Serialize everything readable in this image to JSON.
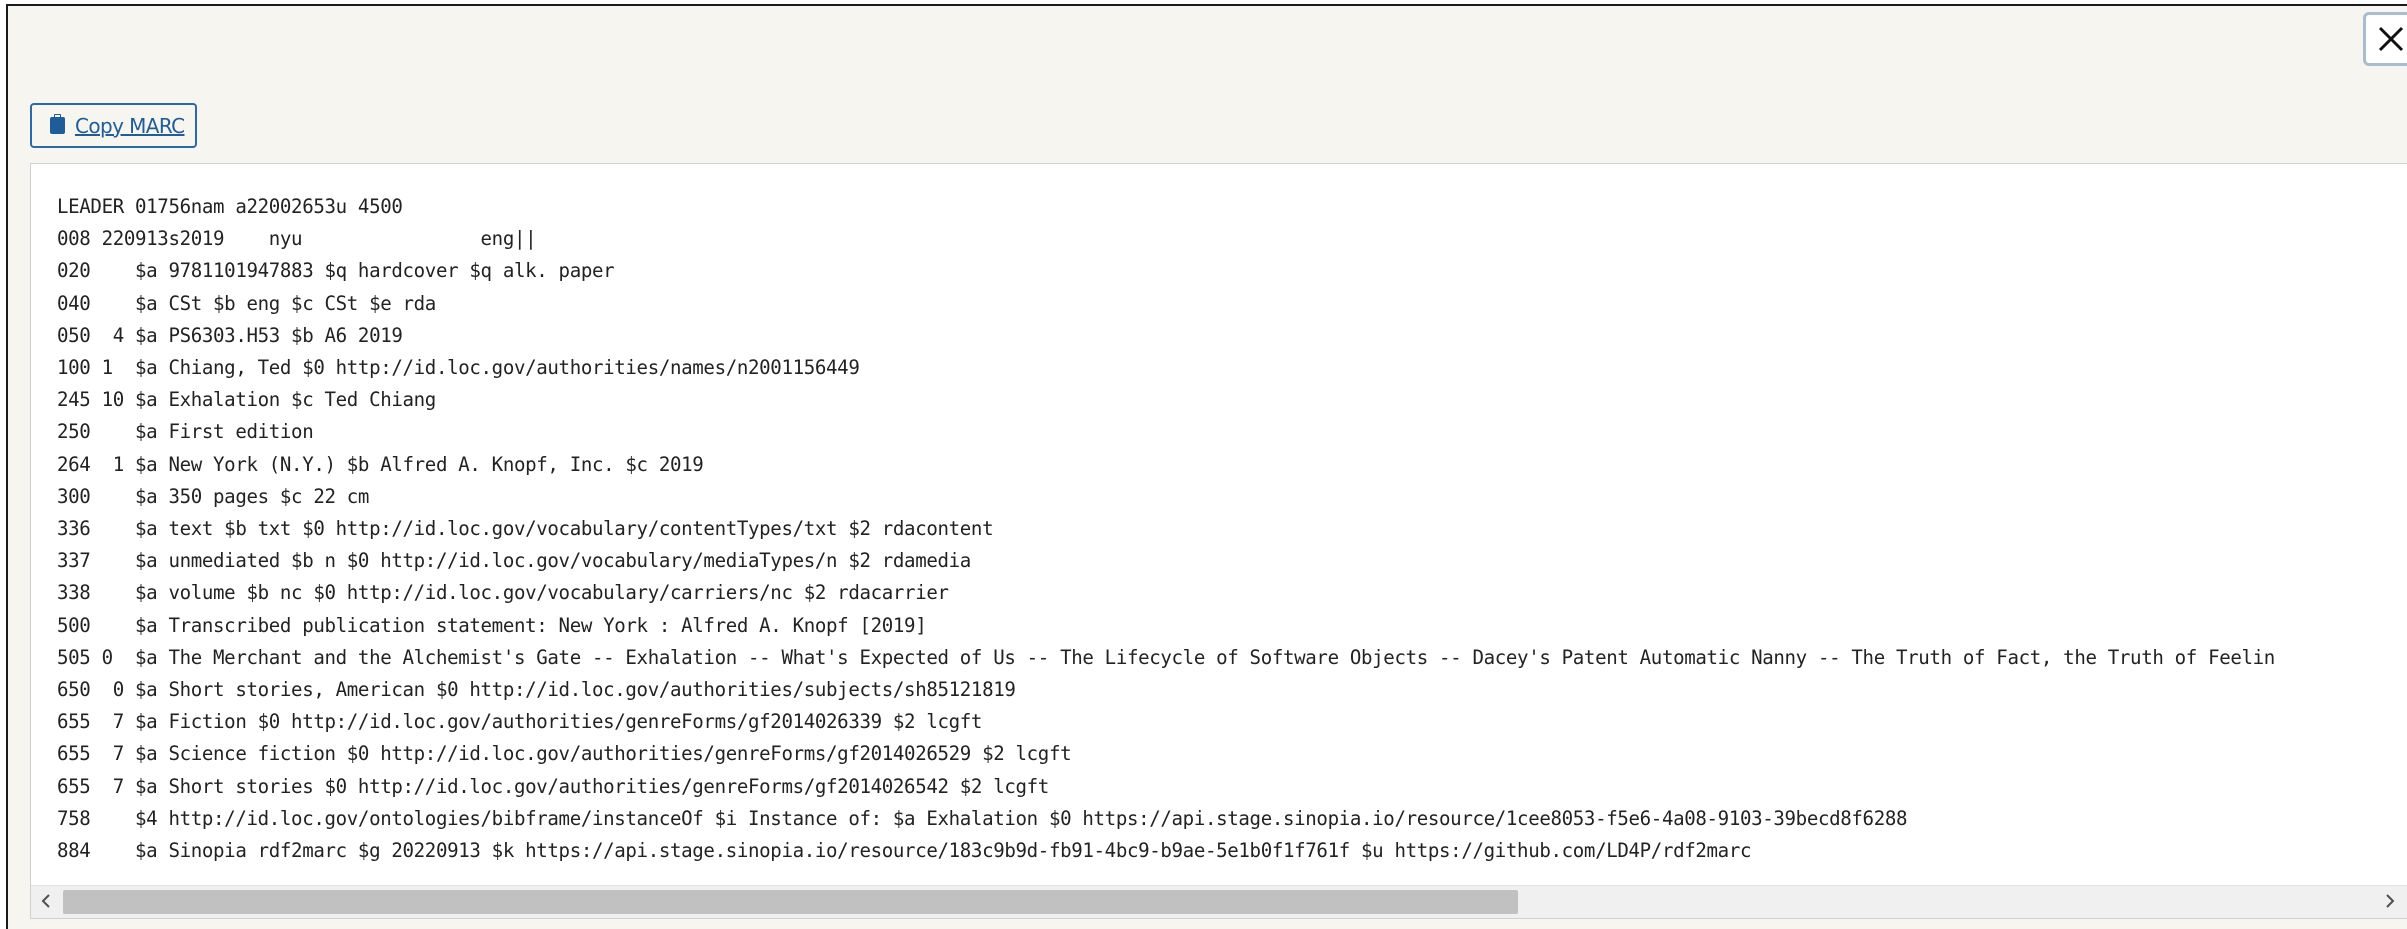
{
  "modal": {
    "close_icon": "close-x-icon",
    "copy_button": {
      "label": "Copy MARC",
      "icon": "clipboard-icon"
    },
    "marc_lines": [
      "LEADER 01756nam a22002653u 4500",
      "008 220913s2019    nyu                eng||",
      "020    $a 9781101947883 $q hardcover $q alk. paper",
      "040    $a CSt $b eng $c CSt $e rda",
      "050  4 $a PS6303.H53 $b A6 2019",
      "100 1  $a Chiang, Ted $0 http://id.loc.gov/authorities/names/n2001156449",
      "245 10 $a Exhalation $c Ted Chiang",
      "250    $a First edition",
      "264  1 $a New York (N.Y.) $b Alfred A. Knopf, Inc. $c 2019",
      "300    $a 350 pages $c 22 cm",
      "336    $a text $b txt $0 http://id.loc.gov/vocabulary/contentTypes/txt $2 rdacontent",
      "337    $a unmediated $b n $0 http://id.loc.gov/vocabulary/mediaTypes/n $2 rdamedia",
      "338    $a volume $b nc $0 http://id.loc.gov/vocabulary/carriers/nc $2 rdacarrier",
      "500    $a Transcribed publication statement: New York : Alfred A. Knopf [2019]",
      "505 0  $a The Merchant and the Alchemist's Gate -- Exhalation -- What's Expected of Us -- The Lifecycle of Software Objects -- Dacey's Patent Automatic Nanny -- The Truth of Fact, the Truth of Feelin",
      "650  0 $a Short stories, American $0 http://id.loc.gov/authorities/subjects/sh85121819",
      "655  7 $a Fiction $0 http://id.loc.gov/authorities/genreForms/gf2014026339 $2 lcgft",
      "655  7 $a Science fiction $0 http://id.loc.gov/authorities/genreForms/gf2014026529 $2 lcgft",
      "655  7 $a Short stories $0 http://id.loc.gov/authorities/genreForms/gf2014026542 $2 lcgft",
      "758    $4 http://id.loc.gov/ontologies/bibframe/instanceOf $i Instance of: $a Exhalation $0 https://api.stage.sinopia.io/resource/1cee8053-f5e6-4a08-9103-39becd8f6288",
      "884    $a Sinopia rdf2marc $g 20220913 $k https://api.stage.sinopia.io/resource/183c9b9d-fb91-4bc9-b9ae-5e1b0f1f761f $u https://github.com/LD4P/rdf2marc"
    ],
    "scrollbar": {
      "left_icon": "chevron-left-icon",
      "right_icon": "chevron-right-icon",
      "visible_fraction": 0.63,
      "position": 0.0
    }
  }
}
